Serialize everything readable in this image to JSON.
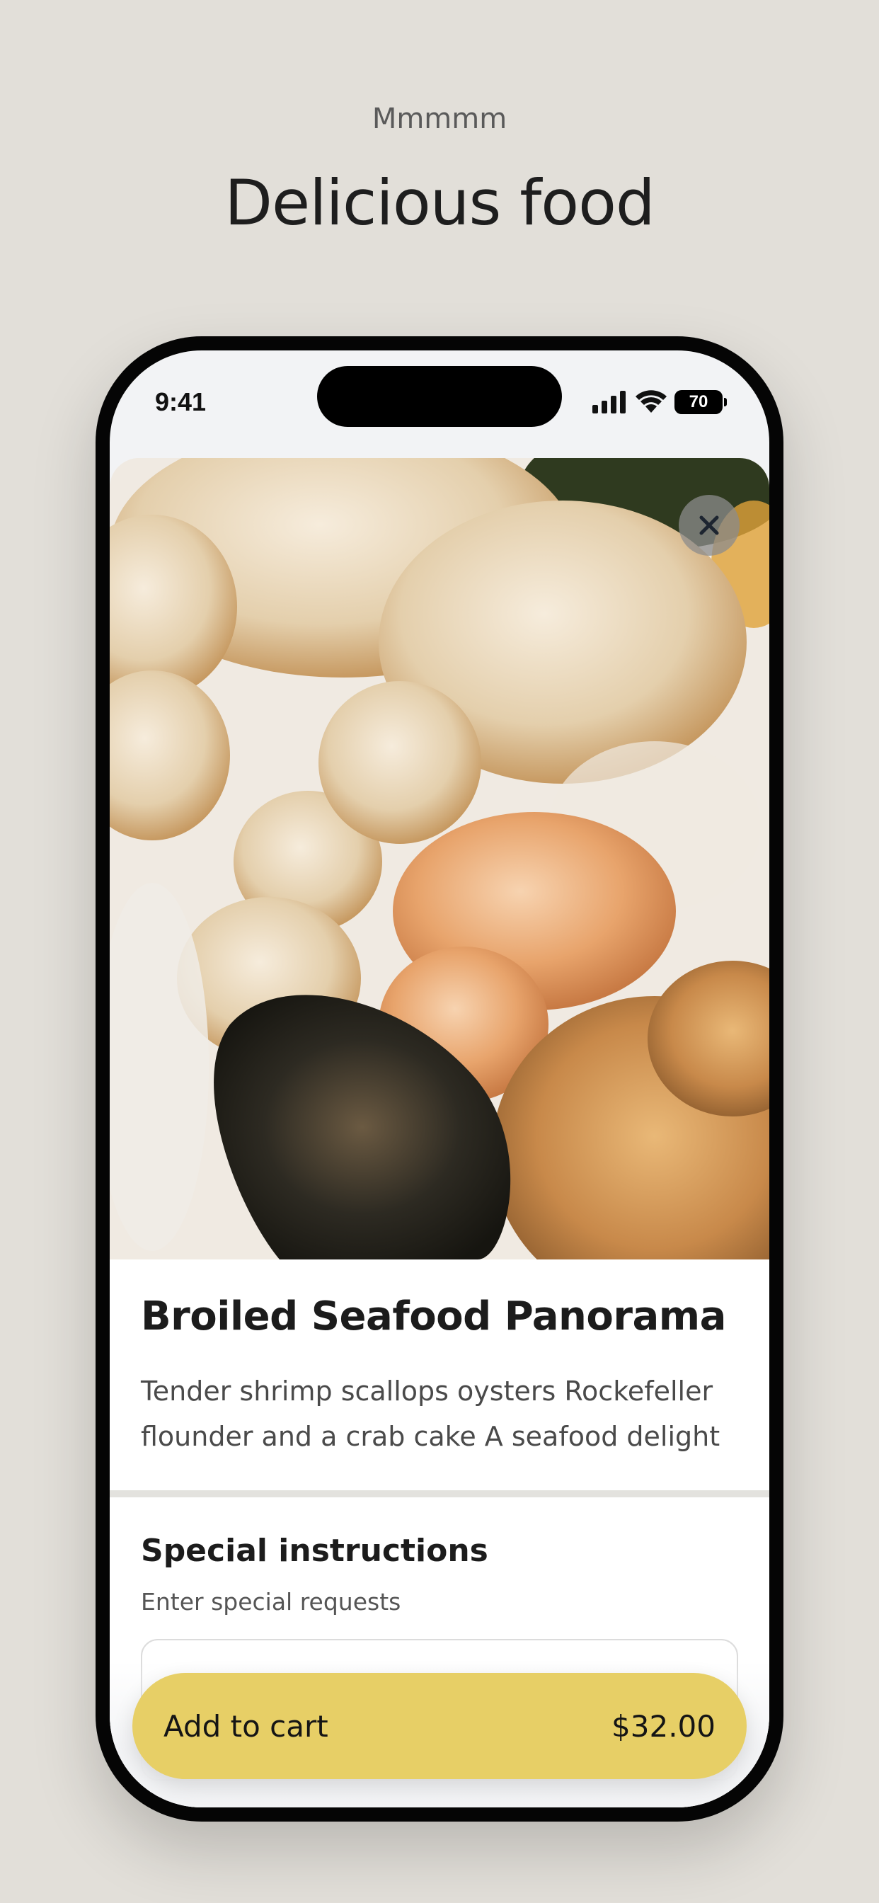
{
  "header": {
    "eyebrow": "Mmmmm",
    "title": "Delicious food"
  },
  "status_bar": {
    "time": "9:41",
    "battery": "70"
  },
  "item": {
    "image_alt": "Broiled seafood plate with shrimp, scallops, oysters and crab cake",
    "title": "Broiled Seafood Panorama",
    "description": "Tender shrimp scallops oysters Rockefeller flounder and a crab cake A seafood delight"
  },
  "instructions": {
    "title": "Special instructions",
    "hint": "Enter special requests",
    "value": ""
  },
  "cart": {
    "label": "Add to cart",
    "price": "$32.00"
  },
  "colors": {
    "background": "#e2dfd9",
    "accent": "#e7cf66"
  },
  "icons": [
    "close-icon",
    "signal-icon",
    "wifi-icon",
    "battery-icon"
  ]
}
